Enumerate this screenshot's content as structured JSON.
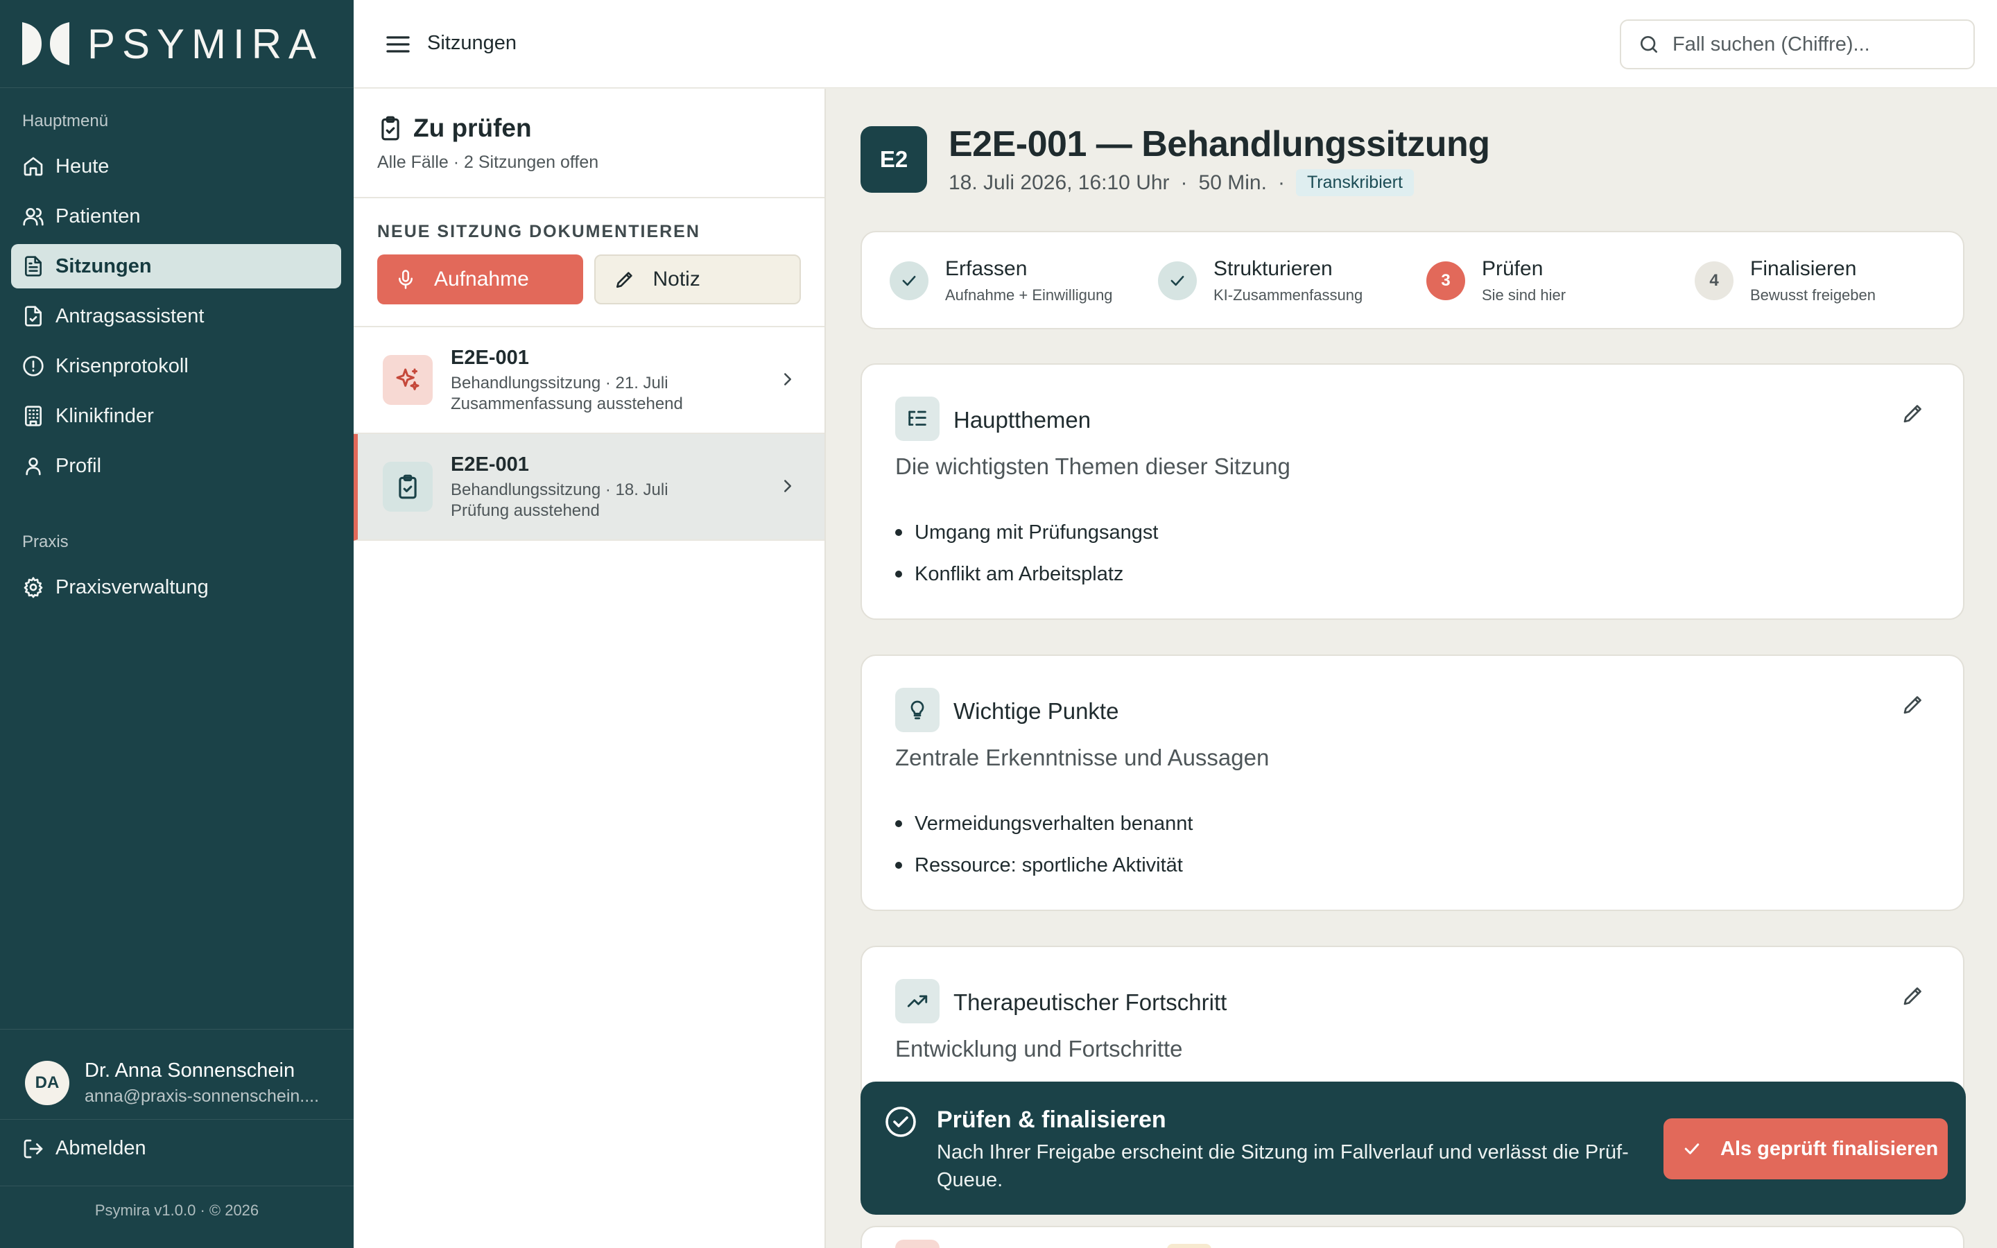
{
  "brand": {
    "name": "PSYMIRA"
  },
  "sidebar": {
    "main_label": "Hauptmenü",
    "items": [
      {
        "label": "Heute",
        "icon": "home-icon"
      },
      {
        "label": "Patienten",
        "icon": "users-icon"
      },
      {
        "label": "Sitzungen",
        "icon": "document-icon",
        "active": true
      },
      {
        "label": "Antragsassistent",
        "icon": "file-text-icon"
      },
      {
        "label": "Krisenprotokoll",
        "icon": "alert-circle-icon"
      },
      {
        "label": "Klinikfinder",
        "icon": "building-icon"
      },
      {
        "label": "Profil",
        "icon": "user-icon"
      }
    ],
    "practice_label": "Praxis",
    "practice_items": [
      {
        "label": "Praxisverwaltung",
        "icon": "gear-icon"
      }
    ],
    "user": {
      "initials": "DA",
      "name": "Dr. Anna Sonnenschein",
      "email": "anna@praxis-sonnenschein...."
    },
    "logout_label": "Abmelden",
    "version": "Psymira v1.0.0 · © 2026"
  },
  "topbar": {
    "title": "Sitzungen",
    "search_placeholder": "Fall suchen (Chiffre)..."
  },
  "queue": {
    "title": "Zu prüfen",
    "subtitle": "Alle Fälle · 2 Sitzungen offen",
    "new_label": "NEUE SITZUNG DOKUMENTIEREN",
    "record_label": "Aufnahme",
    "note_label": "Notiz",
    "items": [
      {
        "id": "E2E-001",
        "line1": "Behandlungssitzung · 21. Juli",
        "line2": "Zusammenfassung ausstehend",
        "icon": "sparkle-icon"
      },
      {
        "id": "E2E-001",
        "line1": "Behandlungssitzung · 18. Juli",
        "line2": "Prüfung ausstehend",
        "icon": "clipboard-check-icon",
        "selected": true
      }
    ]
  },
  "session": {
    "badge": "E2",
    "title": "E2E-001 — Behandlungssitzung",
    "date": "18. Juli 2026, 16:10 Uhr",
    "separator": "·",
    "duration": "50 Min.",
    "status": "Transkribiert"
  },
  "steps": [
    {
      "title": "Erfassen",
      "sub": "Aufnahme + Einwilligung",
      "state": "done"
    },
    {
      "title": "Strukturieren",
      "sub": "KI-Zusammenfassung",
      "state": "done"
    },
    {
      "number": "3",
      "title": "Prüfen",
      "sub": "Sie sind hier",
      "state": "current"
    },
    {
      "number": "4",
      "title": "Finalisieren",
      "sub": "Bewusst freigeben",
      "state": "todo"
    }
  ],
  "cards": [
    {
      "title": "Hauptthemen",
      "subtitle": "Die wichtigsten Themen dieser Sitzung",
      "icon": "list-indent-icon",
      "items": [
        "Umgang mit Prüfungsangst",
        "Konflikt am Arbeitsplatz"
      ]
    },
    {
      "title": "Wichtige Punkte",
      "subtitle": "Zentrale Erkenntnisse und Aussagen",
      "icon": "lightbulb-icon",
      "items": [
        "Vermeidungsverhalten benannt",
        "Ressource: sportliche Aktivität"
      ]
    },
    {
      "title": "Therapeutischer Fortschritt",
      "subtitle": "Entwicklung und Fortschritte",
      "icon": "trending-up-icon",
      "items": []
    }
  ],
  "finalize": {
    "title": "Prüfen & finalisieren",
    "text": "Nach Ihrer Freigabe erscheint die Sitzung im Fallverlauf und verlässt die Prüf-Queue.",
    "button": "Als geprüft finalisieren"
  },
  "colors": {
    "sidebar": "#1b4248",
    "accent": "#e2695a",
    "active_nav": "#d6e4e2",
    "background": "#efeee8"
  }
}
